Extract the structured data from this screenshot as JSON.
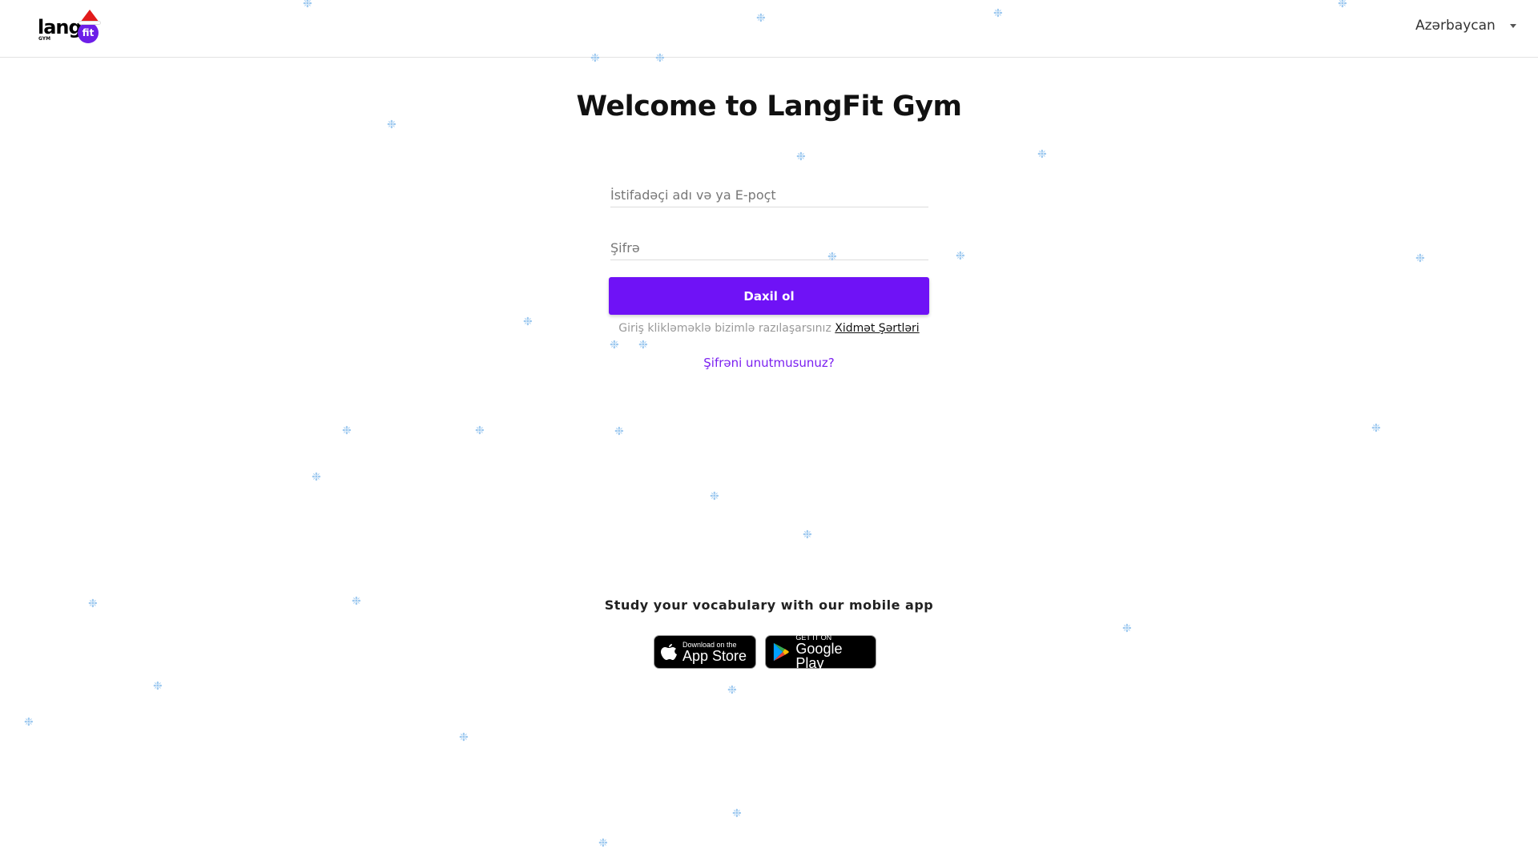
{
  "header": {
    "logo": {
      "word": "lang",
      "sub": "GYM",
      "badge": "fit"
    },
    "language": "Azərbaycan"
  },
  "main": {
    "title": "Welcome to LangFit Gym",
    "username_placeholder": "İstifadəçi adı və ya E-poçt",
    "password_placeholder": "Şifrə",
    "login_button": "Daxil ol",
    "terms_text": "Giriş klikləməklə bizimlə razılaşarsınız",
    "terms_link": "Xidmət Şərtləri",
    "forgot_link": "Şifrəni unutmusunuz?"
  },
  "app": {
    "heading": "Study your vocabulary with our mobile app",
    "appstore": {
      "small": "Download on the",
      "big": "App Store"
    },
    "googleplay": {
      "small": "GET IT ON",
      "big": "Google Play"
    }
  },
  "colors": {
    "accent": "#6f12f6",
    "snow": "#9cc8ef"
  }
}
